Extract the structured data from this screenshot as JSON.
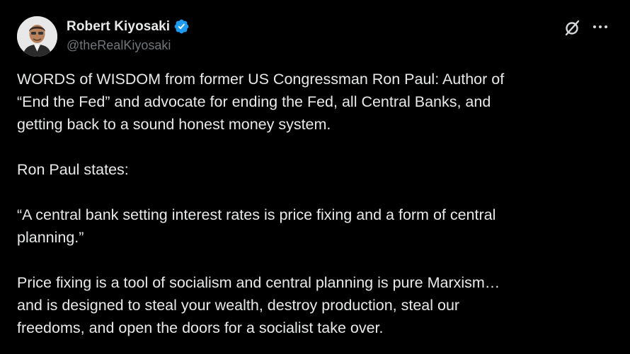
{
  "author": {
    "display_name": "Robert Kiyosaki",
    "handle": "@theRealKiyosaki",
    "verified": true
  },
  "icons": {
    "verified": "verified-badge-icon",
    "grok": "grok-icon",
    "more": "more-options-icon"
  },
  "colors": {
    "background": "#000000",
    "text": "#e7e9ea",
    "secondary": "#71767b",
    "verified_blue": "#1d9bf0"
  },
  "tweet": {
    "lines_p1": [
      "WORDS of WISDOM from former US Congressman Ron Paul:  Author of",
      "“End the Fed” and advocate for ending the Fed, all Central Banks, and",
      "getting back to a sound honest money system."
    ],
    "p2": "Ron Paul states:",
    "lines_p3": [
      "“A central bank setting interest rates is price fixing and a form of central",
      "planning.”"
    ],
    "lines_p4": [
      "Price fixing is a tool of socialism and central planning is pure Marxism…",
      "and is designed to steal your wealth, destroy production, steal our",
      "freedoms, and open the doors for a socialist take over."
    ]
  }
}
